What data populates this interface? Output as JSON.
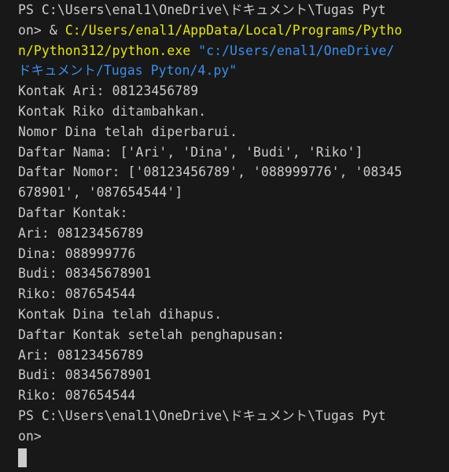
{
  "terminal": {
    "prompt_start": {
      "line1": "PS C:\\Users\\enal1\\OneDrive\\ドキュメント\\Tugas Pyt",
      "line2_prefix": "on> & ",
      "line2_exe": "C:/Users/enal1/AppData/Local/Programs/Pytho",
      "line3_exe": "n/Python312/python.exe",
      "line3_space": " ",
      "line3_arg": "\"c:/Users/enal1/OneDrive/",
      "line4_arg": "ドキュメント/Tugas Pyton/4.py\""
    },
    "output": [
      "Kontak Ari: 08123456789",
      "Kontak Riko ditambahkan.",
      "Nomor Dina telah diperbarui.",
      "Daftar Nama: ['Ari', 'Dina', 'Budi', 'Riko']",
      "Daftar Nomor: ['08123456789', '088999776', '08345",
      "678901', '087654544']",
      "Daftar Kontak:",
      "Ari: 08123456789",
      "Dina: 088999776",
      "Budi: 08345678901",
      "Riko: 087654544",
      "Kontak Dina telah dihapus.",
      "Daftar Kontak setelah penghapusan:",
      "Ari: 08123456789",
      "Budi: 08345678901",
      "Riko: 087654544"
    ],
    "prompt_end": {
      "line1": "PS C:\\Users\\enal1\\OneDrive\\ドキュメント\\Tugas Pyt",
      "line2": "on>"
    },
    "colors": {
      "background": "#181818",
      "text": "#cccccc",
      "exe_path": "#e5e510",
      "string_arg": "#3b8eea"
    }
  }
}
